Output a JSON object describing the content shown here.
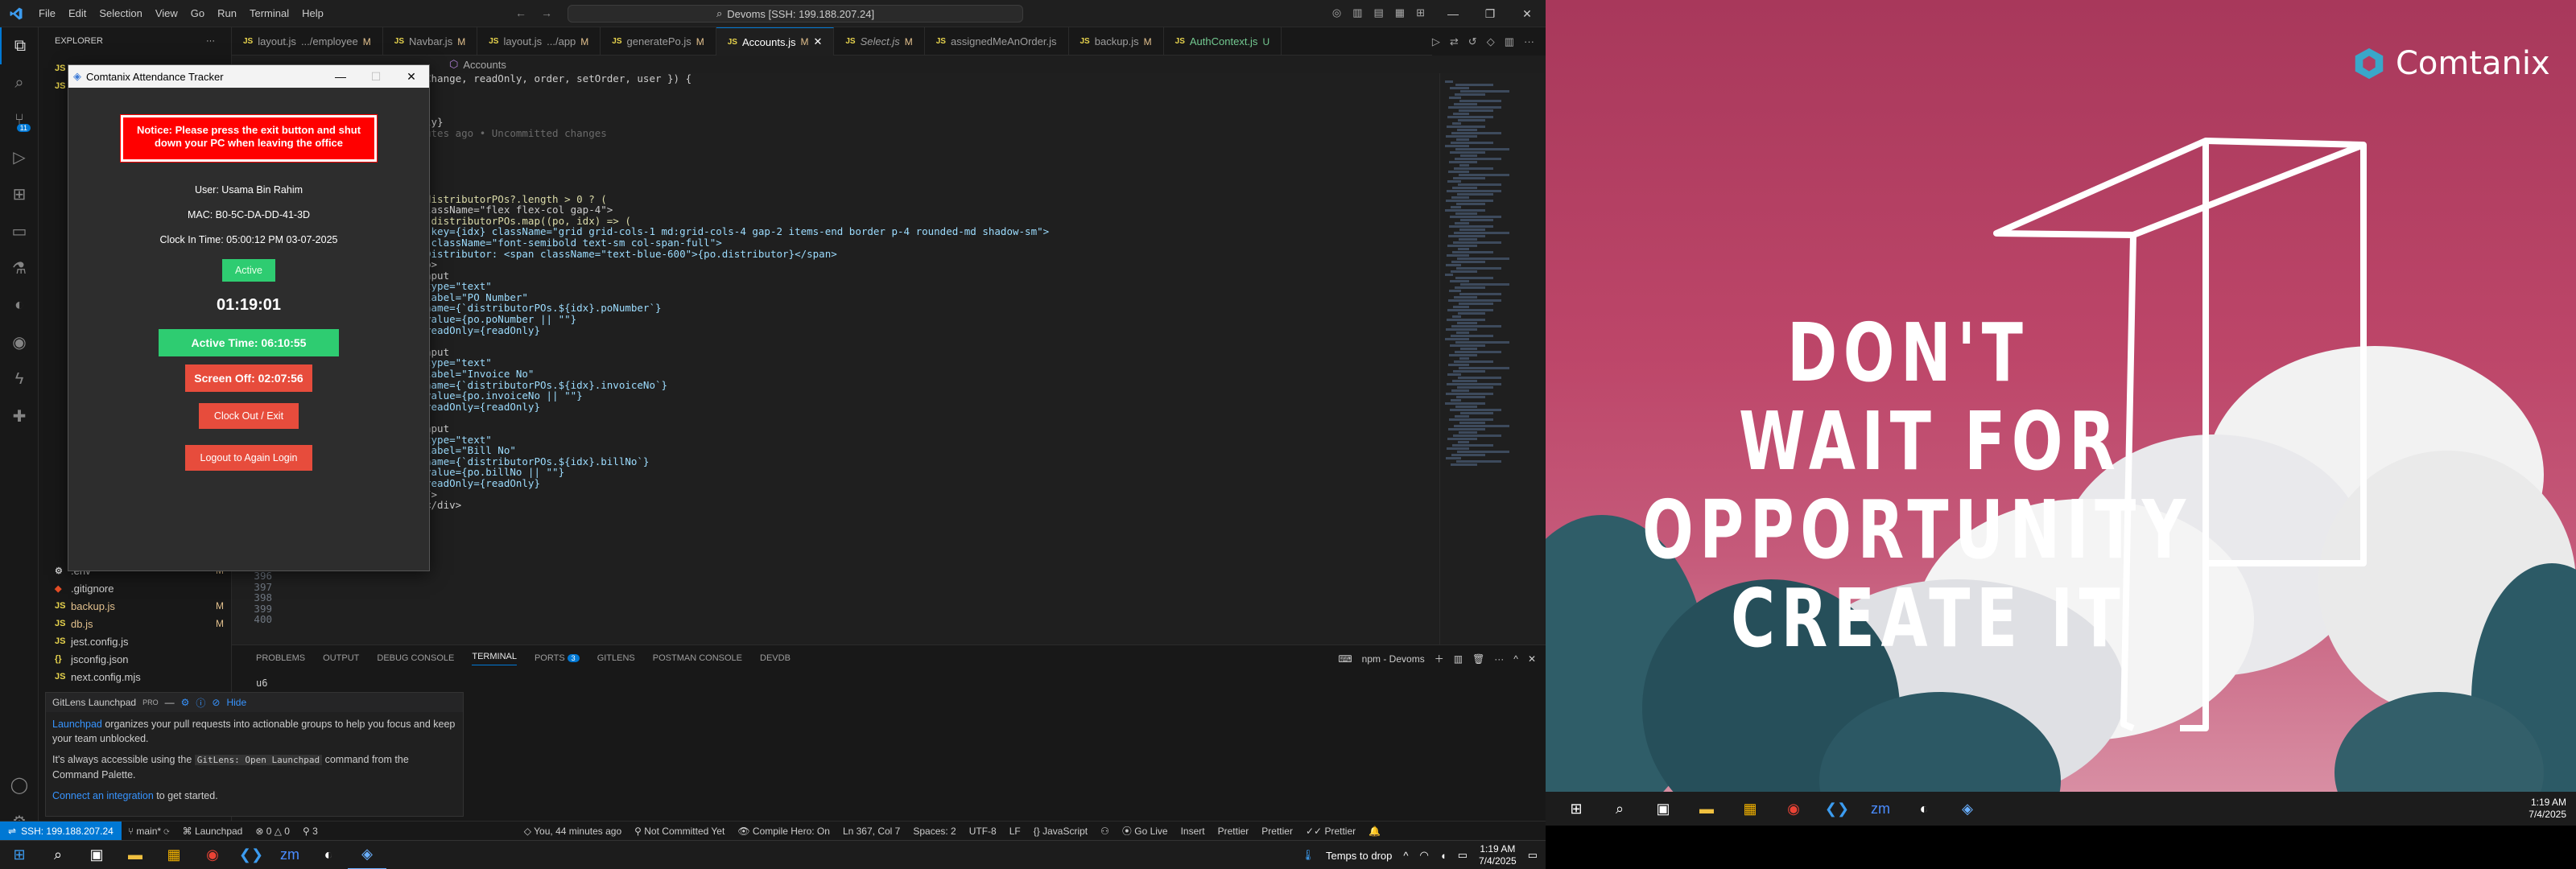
{
  "vscode": {
    "menu": [
      "File",
      "Edit",
      "Selection",
      "View",
      "Go",
      "Run",
      "Terminal",
      "Help"
    ],
    "command_center": "Devoms [SSH: 199.188.207.24]",
    "sidebar": {
      "title": "EXPLORER",
      "files_bottom": [
        {
          "icon": "⚙",
          "name": ".env",
          "mod": "M"
        },
        {
          "icon": "◆",
          "name": ".gitignore",
          "mod": ""
        },
        {
          "icon": "JS",
          "name": "backup.js",
          "mod": "M"
        },
        {
          "icon": "JS",
          "name": "db.js",
          "mod": "M"
        },
        {
          "icon": "JS",
          "name": "jest.config.js",
          "mod": ""
        },
        {
          "icon": "{}",
          "name": "jsconfig.json",
          "mod": ""
        },
        {
          "icon": "JS",
          "name": "next.config.mjs",
          "mod": ""
        }
      ]
    },
    "tabs": [
      {
        "label": "layout.js",
        "sub": ".../employee",
        "mod": "M",
        "active": false
      },
      {
        "label": "Navbar.js",
        "sub": "",
        "mod": "M",
        "active": false
      },
      {
        "label": "layout.js",
        "sub": ".../app",
        "mod": "M",
        "active": false
      },
      {
        "label": "generatePo.js",
        "sub": "",
        "mod": "M",
        "active": false
      },
      {
        "label": "Accounts.js",
        "sub": "",
        "mod": "M",
        "active": true
      },
      {
        "label": "Select.js",
        "sub": "",
        "mod": "M",
        "active": false
      },
      {
        "label": "assignedMeAnOrder.js",
        "sub": "",
        "mod": "",
        "active": false
      },
      {
        "label": "backup.js",
        "sub": "",
        "mod": "M",
        "active": false
      },
      {
        "label": "AuthContext.js",
        "sub": "",
        "mod": "U",
        "active": false
      }
    ],
    "breadcrumb": "Accounts",
    "code_lines": [
      "Change, readOnly, order, setOrder, user }) {",
      "",
      "",
      "",
      "ly}",
      "utes ago • Uncommitted changes",
      "",
      "",
      "",
      "",
      "",
      "distributorPOs?.length > 0 ? (",
      "lassName=\"flex flex-col gap-4\">",
      ".distributorPOs.map((po, idx) => (",
      " key={idx} className=\"grid grid-cols-1 md:grid-cols-4 gap-2 items-end border p-4 rounded-md shadow-sm\">",
      " className=\"font-semibold text-sm col-span-full\">",
      "Distributor: <span className=\"text-blue-600\">{po.distributor}</span>",
      "p>",
      "nput",
      "type=\"text\"",
      "label=\"PO Number\"",
      "name={`distributorPOs.${idx}.poNumber`}",
      "value={po.poNumber || \"\"}",
      "readOnly={readOnly}",
      "",
      "nput",
      "type=\"text\"",
      "label=\"Invoice No\"",
      "name={`distributorPOs.${idx}.invoiceNo`}",
      "value={po.invoiceNo || \"\"}",
      "readOnly={readOnly}",
      "",
      "nput",
      "type=\"text\"",
      "label=\"Bill No\"",
      "name={`distributorPOs.${idx}.billNo`}",
      "value={po.billNo || \"\"}",
      "readOnly={readOnly}",
      "/>",
      "</div>"
    ],
    "line_numbers": [
      "396",
      "397",
      "398",
      "399",
      "400"
    ],
    "panel": {
      "tabs": [
        "PROBLEMS",
        "OUTPUT",
        "DEBUG CONSOLE",
        "TERMINAL",
        "PORTS",
        "GITLENS",
        "POSTMAN CONSOLE",
        "DEVDB"
      ],
      "ports_count": "3",
      "terminal_name": "npm - Devoms",
      "terminal_text": "u6"
    },
    "gitlens": {
      "title": "GitLens Launchpad",
      "badge": "PRO",
      "hide": "Hide",
      "p1_link": "Launchpad",
      "p1": " organizes your pull requests into actionable groups to help you focus and keep your team unblocked.",
      "p2_a": "It's always accessible using the ",
      "p2_code": "GitLens: Open Launchpad",
      "p2_b": " command from the Command Palette.",
      "p3_link": "Connect an integration",
      "p3": " to get started."
    },
    "statusbar": {
      "remote": "SSH: 199.188.207.24",
      "branch": "main*",
      "launchpad": "Launchpad",
      "problems": "0 △ 0",
      "ports": "3",
      "blame": "You, 44 minutes ago",
      "commit": "Not Committed Yet",
      "compile": "Compile Hero: On",
      "position": "Ln 367, Col 7",
      "spaces": "Spaces: 2",
      "encoding": "UTF-8",
      "eol": "LF",
      "language": "JavaScript",
      "golive": "Go Live",
      "insert": "Insert",
      "prettier1": "Prettier",
      "prettier2": "Prettier",
      "prettier3": "Prettier"
    }
  },
  "tracker": {
    "title": "Comtanix Attendance Tracker",
    "notice": "Notice: Please press the exit button and shut down your PC when leaving the office",
    "user": "User: Usama Bin Rahim",
    "mac": "MAC: B0-5C-DA-DD-41-3D",
    "clock_in": "Clock In Time: 05:00:12 PM 03-07-2025",
    "status": "Active",
    "timer": "01:19:01",
    "active_time": "Active Time: 06:10:55",
    "screen_off": "Screen Off: 02:07:56",
    "clock_out": "Clock Out / Exit",
    "logout": "Logout to Again Login"
  },
  "taskbar_left": {
    "weather": "Temps to drop",
    "time": "1:19 AM",
    "date": "7/4/2025"
  },
  "desktop2": {
    "brand": "Comtanix",
    "quote": [
      "DON'T",
      "WAIT FOR",
      "OPPORTUNITY",
      "CREATE IT"
    ],
    "time": "1:19 AM",
    "date": "7/4/2025"
  },
  "colors": {
    "accent": "#0078d4",
    "notice_red": "#ff0000",
    "green": "#2ecc71",
    "red_button": "#e74c3c",
    "wallpaper_pink": "#b23d62"
  }
}
